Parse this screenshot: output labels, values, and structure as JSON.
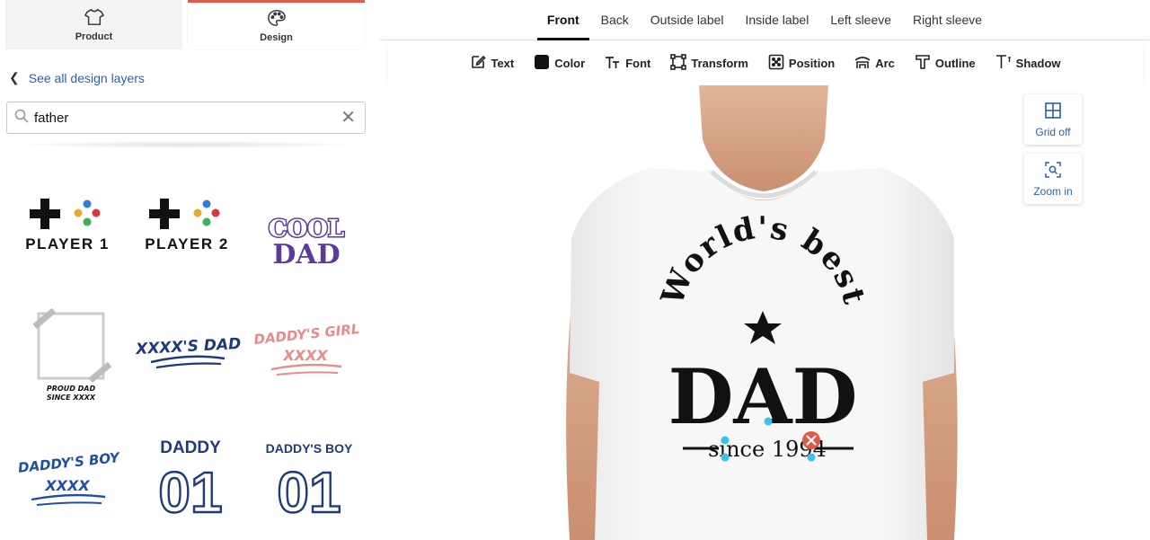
{
  "left_tabs": [
    {
      "label": "Product",
      "icon": "tshirt-icon"
    },
    {
      "label": "Design",
      "icon": "palette-icon"
    }
  ],
  "back_link": "See all design layers",
  "search": {
    "value": "father"
  },
  "designs": [
    {
      "name": "design-player-1",
      "text": "PLAYER 1"
    },
    {
      "name": "design-player-2",
      "text": "PLAYER 2"
    },
    {
      "name": "design-cool-dad",
      "text": [
        "COOL",
        "DAD"
      ]
    },
    {
      "name": "design-proud-dad-photo",
      "text": [
        "PROUD DAD",
        "SINCE XXXX"
      ]
    },
    {
      "name": "design-xxxxs-dad",
      "text": "XXXX'S DAD"
    },
    {
      "name": "design-daddys-girl",
      "text": [
        "DADDY'S GIRL",
        "XXXX"
      ]
    },
    {
      "name": "design-daddys-boy-script",
      "text": [
        "DADDY'S BOY",
        "XXXX"
      ]
    },
    {
      "name": "design-daddy-01",
      "text": [
        "DADDY",
        "01"
      ]
    },
    {
      "name": "design-daddys-boy-01",
      "text": [
        "DADDY'S BOY",
        "01"
      ]
    }
  ],
  "product_tabs": [
    "Front",
    "Back",
    "Outside label",
    "Inside label",
    "Left sleeve",
    "Right sleeve"
  ],
  "active_product_tab": "Front",
  "tools": [
    {
      "label": "Text",
      "icon": "edit-text-icon"
    },
    {
      "label": "Color",
      "icon": "color-swatch-icon"
    },
    {
      "label": "Font",
      "icon": "font-icon"
    },
    {
      "label": "Transform",
      "icon": "transform-icon"
    },
    {
      "label": "Position",
      "icon": "position-icon"
    },
    {
      "label": "Arc",
      "icon": "arc-icon"
    },
    {
      "label": "Outline",
      "icon": "outline-icon"
    },
    {
      "label": "Shadow",
      "icon": "shadow-icon"
    }
  ],
  "side_buttons": [
    {
      "label": "Grid off",
      "icon": "grid-icon"
    },
    {
      "label": "Zoom in",
      "icon": "zoom-in-icon"
    }
  ],
  "shirt_print": {
    "arc_text": "World's best",
    "main_text": "DAD",
    "sub_text": "since 1994"
  },
  "colors": {
    "accent": "#e05a47",
    "link": "#2b5fb0",
    "navy": "#1f3a7a",
    "purple": "#5b3a9a",
    "pink": "#e88a8a"
  }
}
